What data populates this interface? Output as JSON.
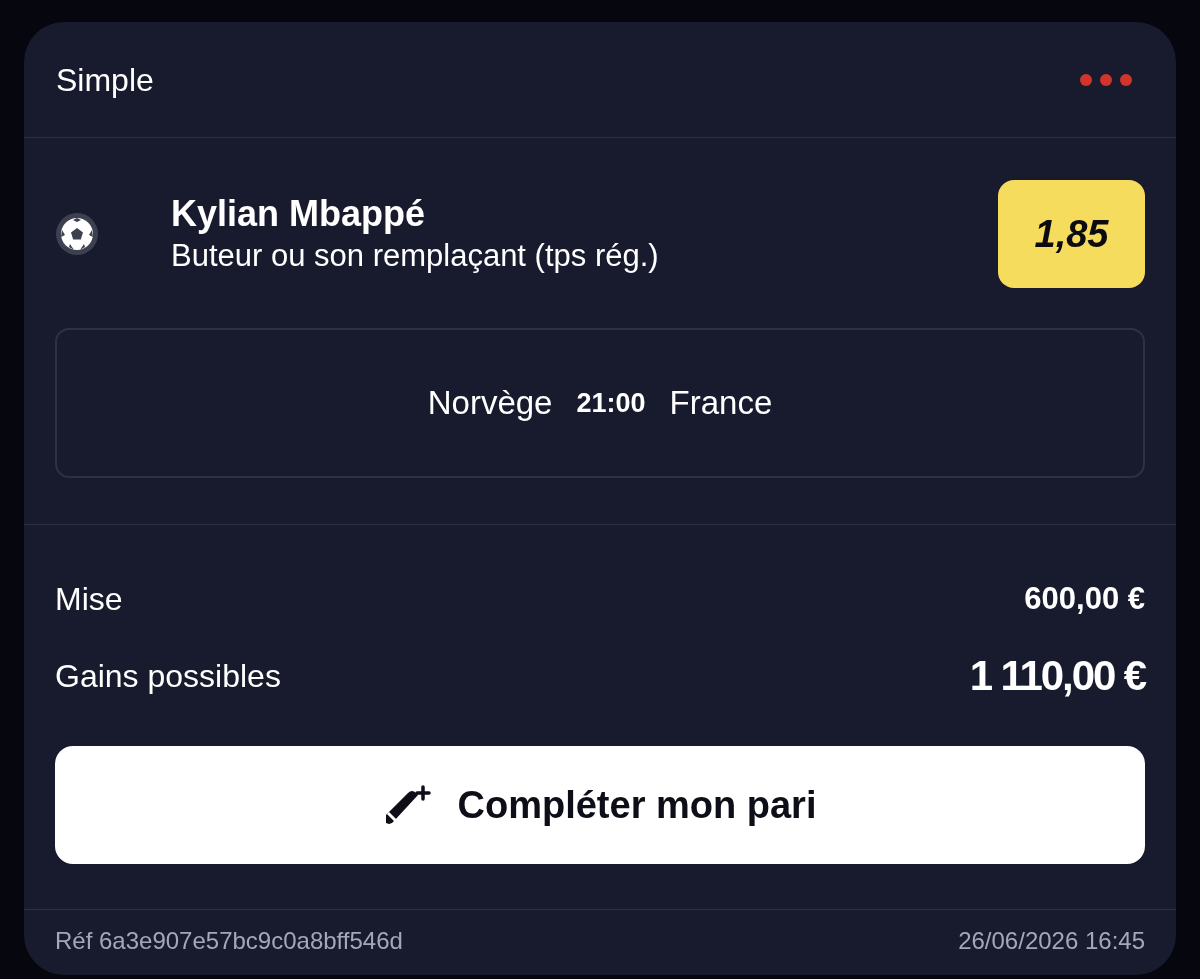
{
  "bet_slip": {
    "title": "Simple"
  },
  "selection": {
    "player": "Kylian Mbappé",
    "market": "Buteur ou son remplaçant (tps rég.)",
    "odds": "1,85"
  },
  "match": {
    "home": "Norvège",
    "time": "21:00",
    "away": "France"
  },
  "summary": [
    {
      "kind": "stake",
      "label": "Mise",
      "value": "600,00 €"
    },
    {
      "kind": "payout",
      "label": "Gains possibles",
      "value": "1 110,00 €"
    }
  ],
  "action_button": {
    "label": "Compléter mon pari"
  },
  "footer": {
    "reference": "Réf 6a3e907e57bc9c0a8bff546d",
    "date": "26/06/2026 16:45"
  }
}
